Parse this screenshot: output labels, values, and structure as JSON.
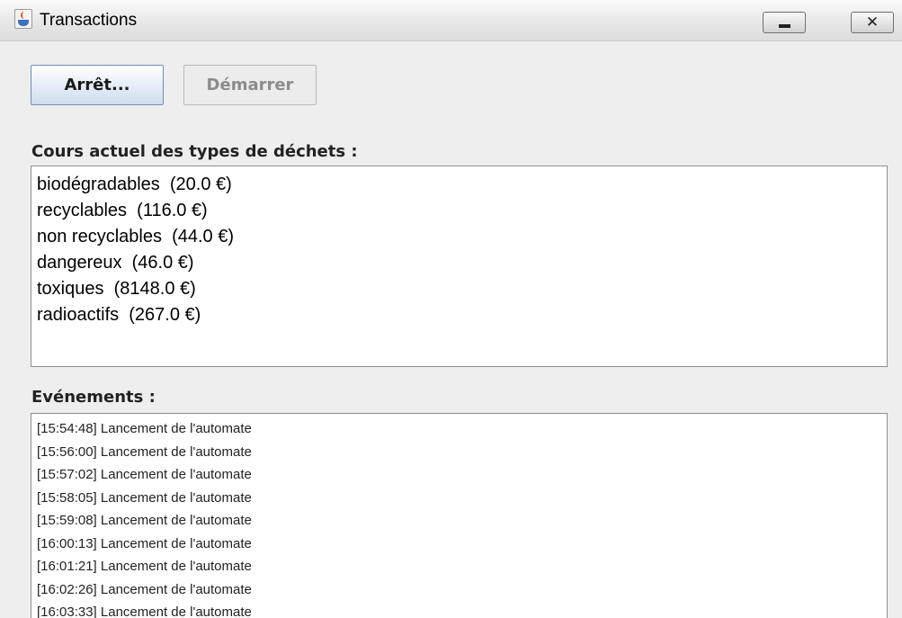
{
  "window": {
    "title": "Transactions",
    "close_glyph": "✕",
    "icons": {
      "app": "java-cup-icon",
      "minimize": "minimize-icon",
      "close": "close-icon"
    }
  },
  "toolbar": {
    "stop_label": "Arrêt...",
    "start_label": "Démarrer"
  },
  "rates": {
    "heading": "Cours actuel des types de déchets :",
    "items": [
      "biodégradables  (20.0 €)",
      "recyclables  (116.0 €)",
      "non recyclables  (44.0 €)",
      "dangereux  (46.0 €)",
      "toxiques  (8148.0 €)",
      "radioactifs  (267.0 €)"
    ]
  },
  "events": {
    "heading": "Evénements :",
    "items": [
      "[15:54:48] Lancement de l'automate",
      "[15:56:00] Lancement de l'automate",
      "[15:57:02] Lancement de l'automate",
      "[15:58:05] Lancement de l'automate",
      "[15:59:08] Lancement de l'automate",
      "[16:00:13] Lancement de l'automate",
      "[16:01:21] Lancement de l'automate",
      "[16:02:26] Lancement de l'automate",
      "[16:03:33] Lancement de l'automate"
    ]
  }
}
